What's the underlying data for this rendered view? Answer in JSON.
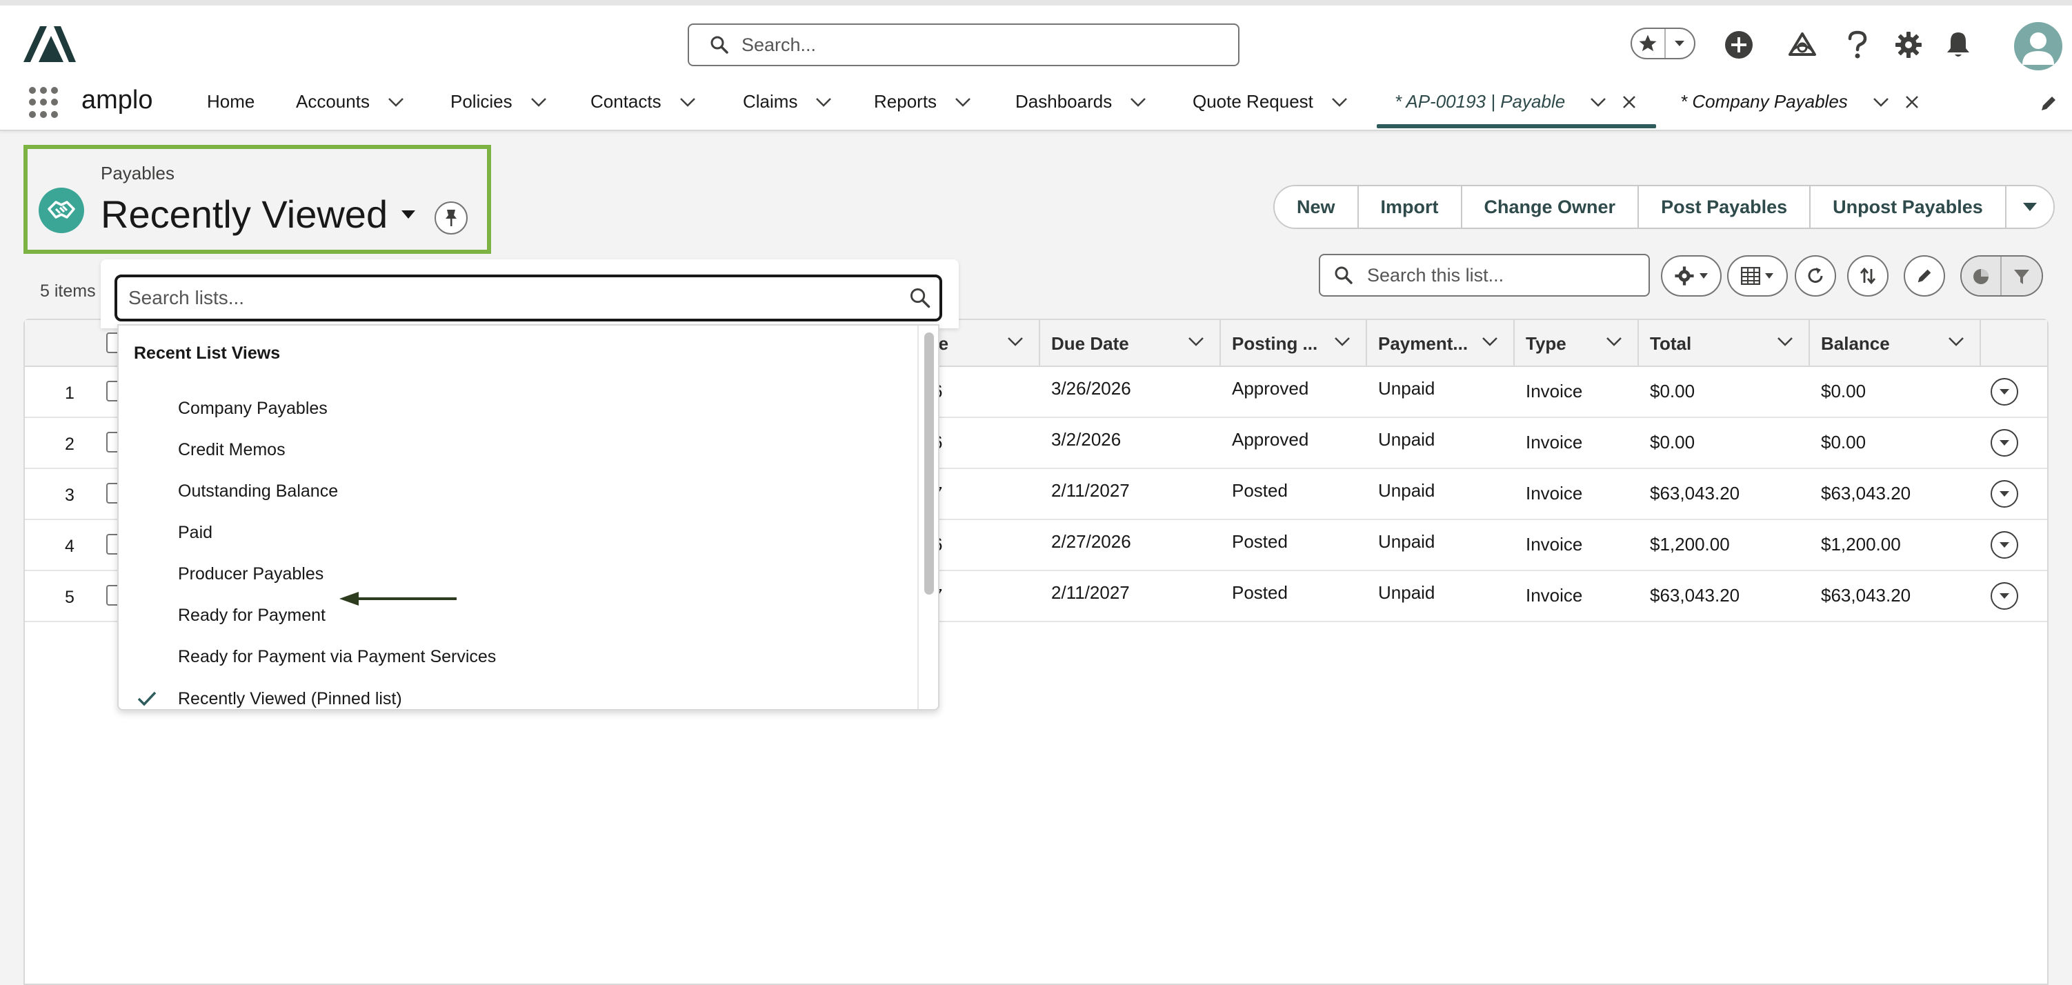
{
  "header": {
    "search_placeholder": "Search...",
    "icons": [
      "favorites-star-icon",
      "add-icon",
      "trailhead-icon",
      "help-icon",
      "setup-gear-icon",
      "notifications-bell-icon",
      "user-avatar-icon"
    ]
  },
  "nav": {
    "app_name": "amplo",
    "items": [
      {
        "label": "Home",
        "has_menu": false
      },
      {
        "label": "Accounts",
        "has_menu": true
      },
      {
        "label": "Policies",
        "has_menu": true
      },
      {
        "label": "Contacts",
        "has_menu": true
      },
      {
        "label": "Claims",
        "has_menu": true
      },
      {
        "label": "Reports",
        "has_menu": true
      },
      {
        "label": "Dashboards",
        "has_menu": true
      },
      {
        "label": "Quote Request",
        "has_menu": true
      }
    ],
    "tabs": [
      {
        "label": "* AP-00193 | Payable",
        "active": true
      },
      {
        "label": "* Company Payables",
        "active": false
      }
    ]
  },
  "list_view": {
    "object_label": "Payables",
    "title": "Recently Viewed",
    "items_count": "5 items",
    "actions": [
      "New",
      "Import",
      "Change Owner",
      "Post Payables",
      "Unpost Payables"
    ],
    "search_placeholder": "Search this list..."
  },
  "table": {
    "columns": [
      "Due Date",
      "Posting ...",
      "Payment...",
      "Type",
      "Total",
      "Balance"
    ],
    "rows": [
      {
        "num": "1",
        "partial": "6",
        "due_date": "3/26/2026",
        "posting": "Approved",
        "payment": "Unpaid",
        "type": "Invoice",
        "total": "$0.00",
        "balance": "$0.00"
      },
      {
        "num": "2",
        "partial": "6",
        "due_date": "3/2/2026",
        "posting": "Approved",
        "payment": "Unpaid",
        "type": "Invoice",
        "total": "$0.00",
        "balance": "$0.00"
      },
      {
        "num": "3",
        "partial": "7",
        "due_date": "2/11/2027",
        "posting": "Posted",
        "payment": "Unpaid",
        "type": "Invoice",
        "total": "$63,043.20",
        "balance": "$63,043.20"
      },
      {
        "num": "4",
        "partial": "6",
        "due_date": "2/27/2026",
        "posting": "Posted",
        "payment": "Unpaid",
        "type": "Invoice",
        "total": "$1,200.00",
        "balance": "$1,200.00"
      },
      {
        "num": "5",
        "partial": "7",
        "due_date": "2/11/2027",
        "posting": "Posted",
        "payment": "Unpaid",
        "type": "Invoice",
        "total": "$63,043.20",
        "balance": "$63,043.20"
      }
    ]
  },
  "dropdown": {
    "search_placeholder": "Search lists...",
    "section_title": "Recent List Views",
    "items": [
      {
        "label": "Company Payables",
        "selected": false
      },
      {
        "label": "Credit Memos",
        "selected": false
      },
      {
        "label": "Outstanding Balance",
        "selected": false
      },
      {
        "label": "Paid",
        "selected": false
      },
      {
        "label": "Producer Payables",
        "selected": false
      },
      {
        "label": "Ready for Payment",
        "selected": false
      },
      {
        "label": "Ready for Payment via Payment Services",
        "selected": false
      },
      {
        "label": "Recently Viewed (Pinned list)",
        "selected": true
      }
    ]
  },
  "colors": {
    "brand_teal": "#2e5c5c",
    "object_icon": "#3ba596",
    "highlight_box": "#7cb342",
    "annotation_arrow": "#2d3b1f"
  }
}
